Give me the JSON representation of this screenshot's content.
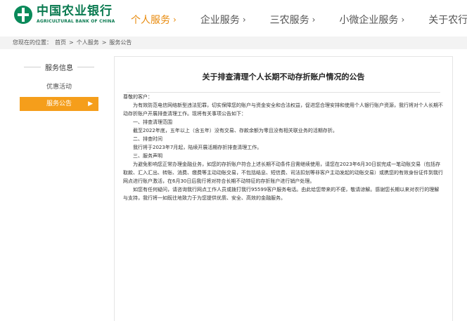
{
  "brand": {
    "name_cn": "中国农业银行",
    "name_en": "AGRICULTURAL BANK OF CHINA",
    "accent": "#e88a0c",
    "brand_green": "#0a7a50"
  },
  "nav": {
    "items": [
      {
        "label": "个人服务",
        "active": true
      },
      {
        "label": "企业服务"
      },
      {
        "label": "三农服务"
      },
      {
        "label": "小微企业服务"
      },
      {
        "label": "关于农行"
      }
    ],
    "chevron": "›"
  },
  "breadcrumb": {
    "prefix": "您现在的位置：",
    "items": [
      "首页",
      "个人服务",
      "服务公告"
    ],
    "separator": ">"
  },
  "sidebar": {
    "title": "服务信息",
    "items": [
      {
        "label": "优惠活动"
      },
      {
        "label": "服务公告",
        "active": true
      }
    ]
  },
  "notice": {
    "title": "关于排查清理个人长期不动存折账户情况的公告",
    "greeting": "尊敬的客户：",
    "intro": "为有效防范电信网络新型违法犯罪，切实保障您的账户与资金安全和合法权益，促进您合理安排和使用个人银行账户资源，我行将对个人长期不动存折账户开展排查清理工作。现将有关事项公告如下：",
    "sections": [
      {
        "heading": "一、排查清理范围",
        "text": "截至2022年底，五年以上（含五年）没有交易、存款余额为零且没有相关联业务的活期存折。"
      },
      {
        "heading": "二、排查时间",
        "text": "我行将于2023年7月起，陆续开展活期存折排查清理工作。"
      },
      {
        "heading": "三、服务声明",
        "text": "为避免影响您正常办理金融业务，如您的存折账户符合上述长期不动条件且需继续使用，请您在2023年6月30日前完成一笔动账交易（包括存取款、汇入汇出、转账、消费、缴费等主动动账交易，不包括结息、短信费、司法扣划等非客户主动发起的动账交易）或携您的有效身份证件到我行网点进行账户激活，在6月30日后我行将对符合长期不动特征的存折账户进行销户处理。"
      }
    ],
    "closing": "如您有任何疑问，请咨询我行网点工作人员或拨打我行95599客户服务电话。由此给您带来的不便，敬请谅解。感谢您长期以来对农行的理解与支持，我行将一如既往地致力于为您提供优质、安全、高效的金融服务。"
  }
}
